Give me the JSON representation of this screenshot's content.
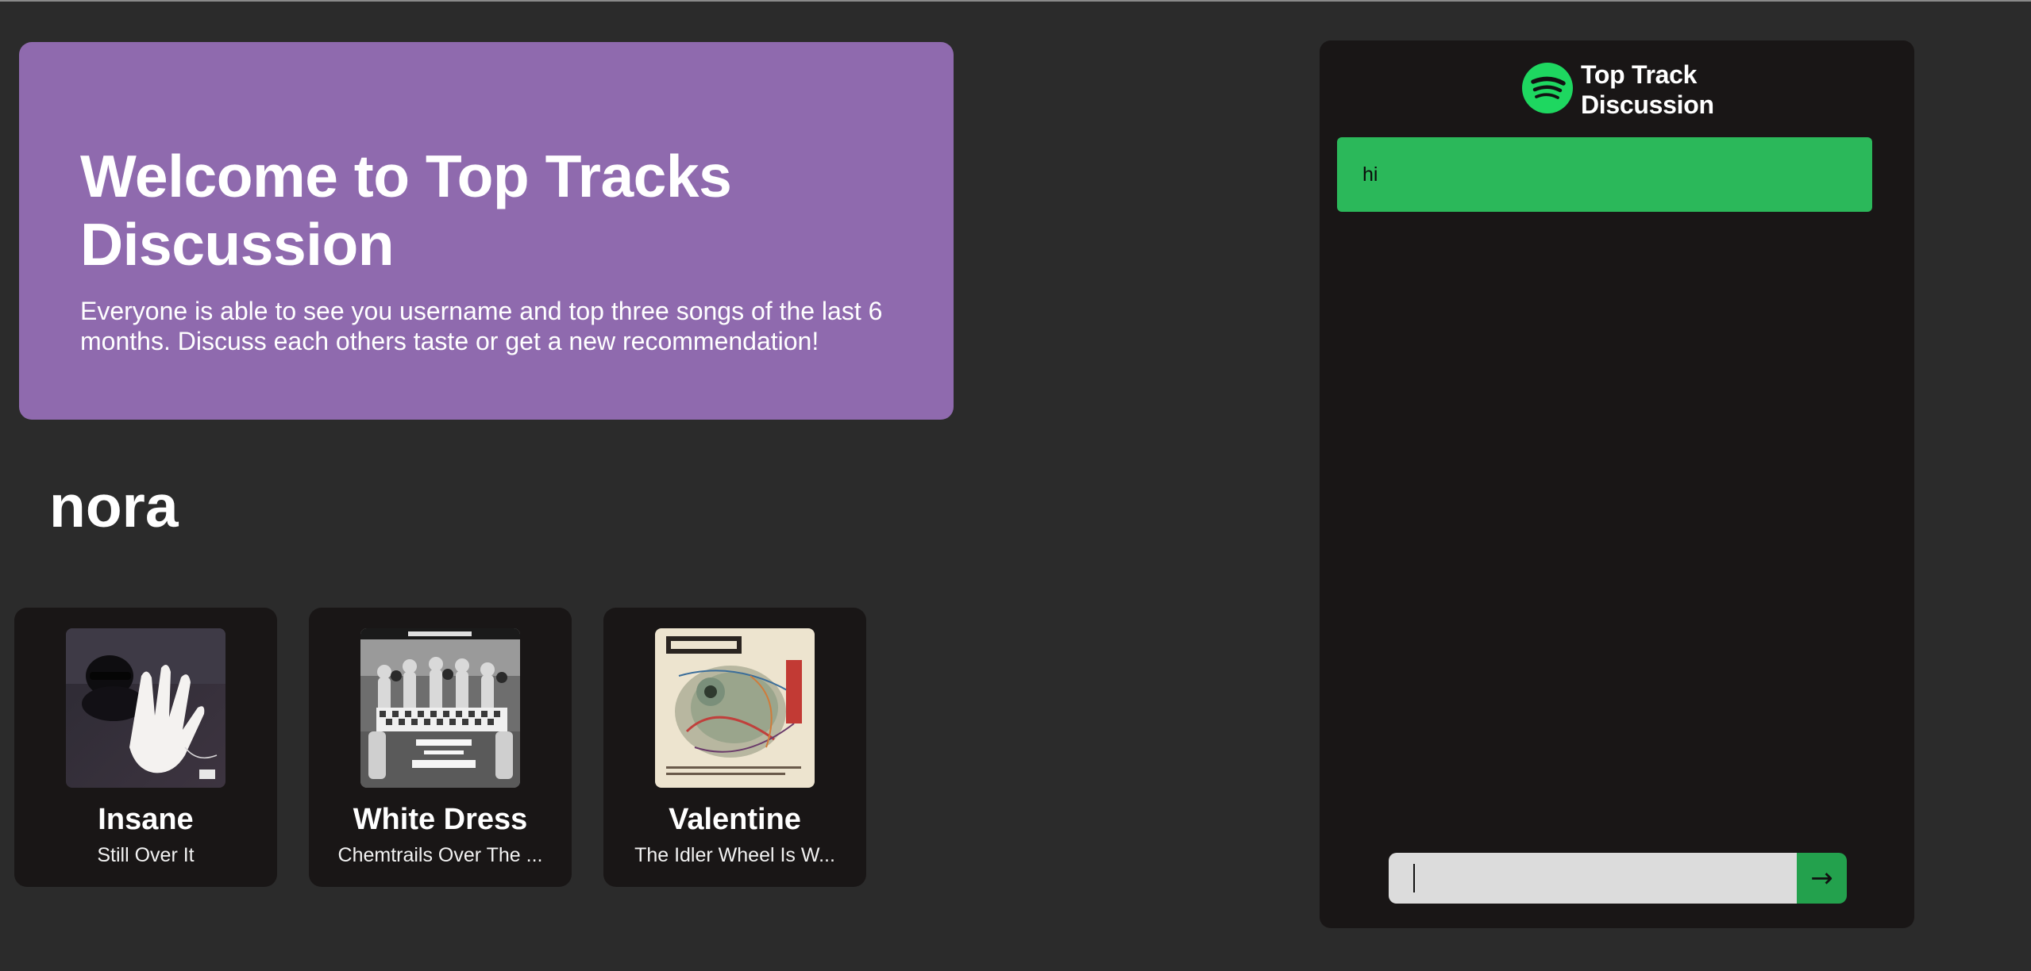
{
  "welcome": {
    "title": "Welcome to Top Tracks Discussion",
    "description": "Everyone is able to see you username and top three songs of the last 6 months. Discuss each others taste or get a new recommendation!"
  },
  "user": {
    "username": "nora"
  },
  "tracks": [
    {
      "title": "Insane",
      "album": "Still Over It",
      "cover_icon": "album-cover"
    },
    {
      "title": "White Dress",
      "album": "Chemtrails Over The ...",
      "cover_icon": "album-cover"
    },
    {
      "title": "Valentine",
      "album": "The Idler Wheel Is W...",
      "cover_icon": "album-cover"
    }
  ],
  "chat": {
    "title": "Top Track Discussion",
    "logo_icon": "spotify-icon",
    "messages": [
      {
        "text": "hi"
      }
    ],
    "input_value": "",
    "input_placeholder": "",
    "send_label": "→"
  },
  "colors": {
    "background": "#2b2b2b",
    "welcome_card": "#8f6aae",
    "panel": "#191616",
    "message_bubble": "#2bb85a",
    "send_button": "#23a14d",
    "spotify_green": "#1ed760"
  }
}
